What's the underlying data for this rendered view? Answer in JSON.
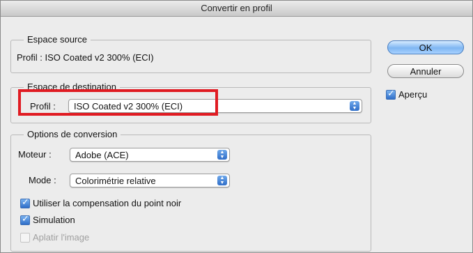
{
  "window": {
    "title": "Convertir en profil"
  },
  "source": {
    "legend": "Espace source",
    "profile_line": "Profil : ISO Coated v2 300% (ECI)"
  },
  "destination": {
    "legend": "Espace de destination",
    "profile_label": "Profil :",
    "profile_value": "ISO Coated v2 300% (ECI)",
    "highlight_color": "#e01b22"
  },
  "options": {
    "legend": "Options de conversion",
    "engine_label": "Moteur :",
    "engine_value": "Adobe (ACE)",
    "mode_label": "Mode :",
    "mode_value": "Colorimétrie relative",
    "black_point": {
      "label": "Utiliser la compensation du point noir",
      "checked": true
    },
    "simulation": {
      "label": "Simulation",
      "checked": true
    },
    "flatten": {
      "label": "Aplatir l'image",
      "checked": false,
      "enabled": false
    }
  },
  "buttons": {
    "ok": "OK",
    "cancel": "Annuler"
  },
  "preview": {
    "label": "Aperçu",
    "checked": true
  },
  "colors": {
    "accent": "#2f6ec8",
    "highlight": "#e01b22"
  }
}
